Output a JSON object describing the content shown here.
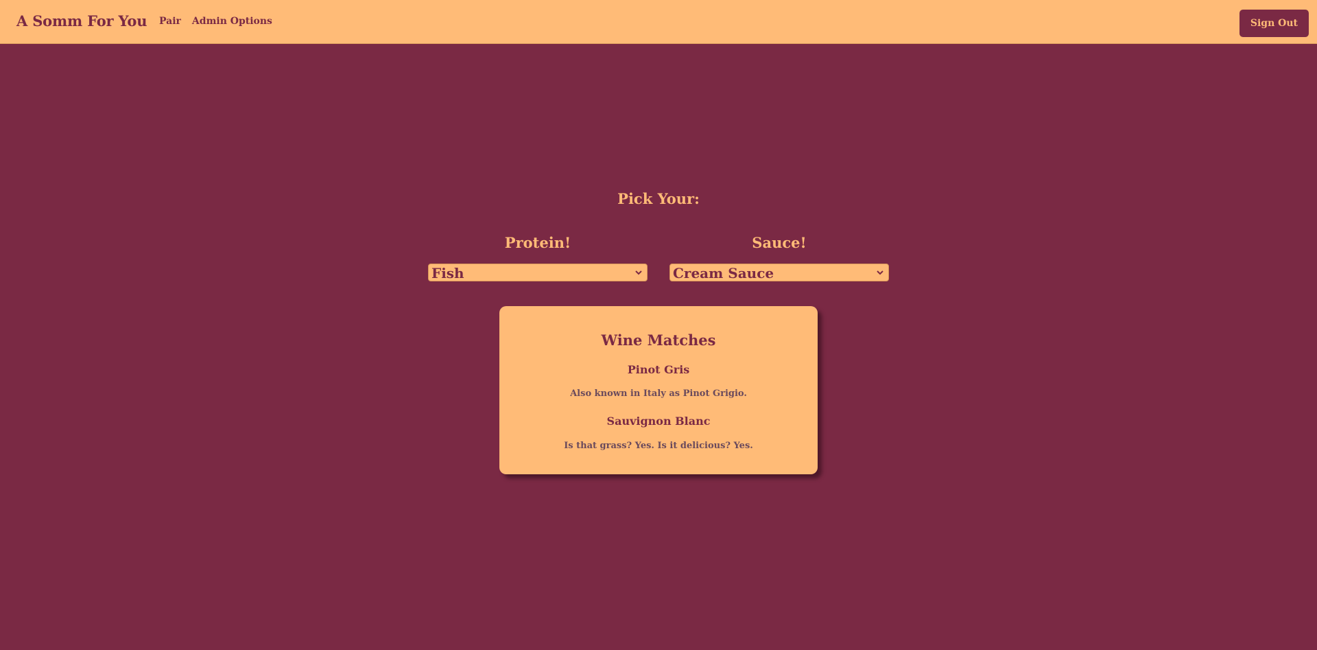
{
  "navbar": {
    "brand": "A Somm For You",
    "links": [
      "Pair",
      "Admin Options"
    ],
    "signout_label": "Sign Out"
  },
  "picker": {
    "title": "Pick Your:",
    "protein": {
      "label": "Protein!",
      "selected": "Fish"
    },
    "sauce": {
      "label": "Sauce!",
      "selected": "Cream Sauce"
    }
  },
  "matches": {
    "title": "Wine Matches",
    "wines": [
      {
        "name": "Pinot Gris",
        "description": "Also known in Italy as Pinot Grigio."
      },
      {
        "name": "Sauvignon Blanc",
        "description": "Is that grass? Yes. Is it delicious? Yes."
      }
    ]
  },
  "colors": {
    "background": "#7a2944",
    "accent": "#ffbb77"
  },
  "icons": {
    "select_arrow": "chevron-down-icon"
  }
}
